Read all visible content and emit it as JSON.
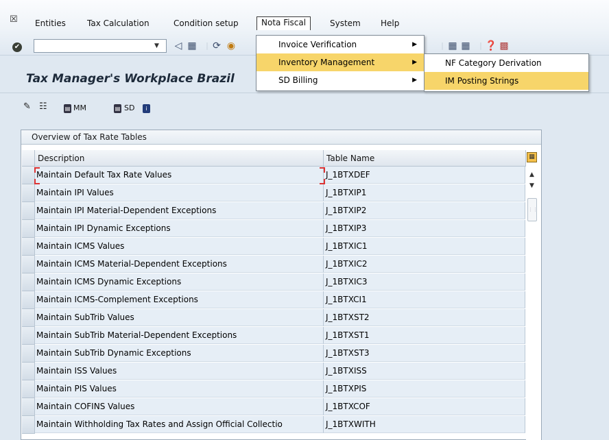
{
  "menubar": {
    "items": [
      {
        "label": "Entities"
      },
      {
        "label": "Tax Calculation"
      },
      {
        "label": "Condition setup"
      },
      {
        "label": "Nota Fiscal"
      },
      {
        "label": "System"
      },
      {
        "label": "Help"
      }
    ]
  },
  "toolbar": {
    "command_value": ""
  },
  "page": {
    "title": "Tax Manager's Workplace Brazil"
  },
  "app_toolbar": {
    "mm_label": "MM",
    "sd_label": "SD"
  },
  "table": {
    "title": "Overview of Tax Rate Tables",
    "columns": [
      "Description",
      "Table Name"
    ],
    "rows": [
      {
        "description": "Maintain Default Tax Rate Values",
        "table": "J_1BTXDEF"
      },
      {
        "description": "Maintain IPI Values",
        "table": "J_1BTXIP1"
      },
      {
        "description": "Maintain IPI Material-Dependent Exceptions",
        "table": "J_1BTXIP2"
      },
      {
        "description": "Maintain IPI Dynamic Exceptions",
        "table": "J_1BTXIP3"
      },
      {
        "description": "Maintain ICMS Values",
        "table": "J_1BTXIC1"
      },
      {
        "description": "Maintain ICMS Material-Dependent Exceptions",
        "table": "J_1BTXIC2"
      },
      {
        "description": "Maintain ICMS Dynamic Exceptions",
        "table": "J_1BTXIC3"
      },
      {
        "description": "Maintain ICMS-Complement Exceptions",
        "table": "J_1BTXCI1"
      },
      {
        "description": "Maintain SubTrib Values",
        "table": "J_1BTXST2"
      },
      {
        "description": "Maintain SubTrib Material-Dependent Exceptions",
        "table": "J_1BTXST1"
      },
      {
        "description": "Maintain SubTrib Dynamic Exceptions",
        "table": "J_1BTXST3"
      },
      {
        "description": "Maintain ISS Values",
        "table": "J_1BTXISS"
      },
      {
        "description": "Maintain PIS Values",
        "table": "J_1BTXPIS"
      },
      {
        "description": "Maintain COFINS Values",
        "table": "J_1BTXCOF"
      },
      {
        "description": "Maintain Withholding Tax Rates and Assign Official Collectio",
        "table": "J_1BTXWITH"
      }
    ]
  },
  "dropdown": {
    "items": [
      {
        "label": "Invoice Verification"
      },
      {
        "label": "Inventory Management"
      },
      {
        "label": "SD Billing"
      }
    ],
    "submenu": [
      {
        "label": "NF Category Derivation"
      },
      {
        "label": "IM Posting Strings"
      }
    ]
  }
}
